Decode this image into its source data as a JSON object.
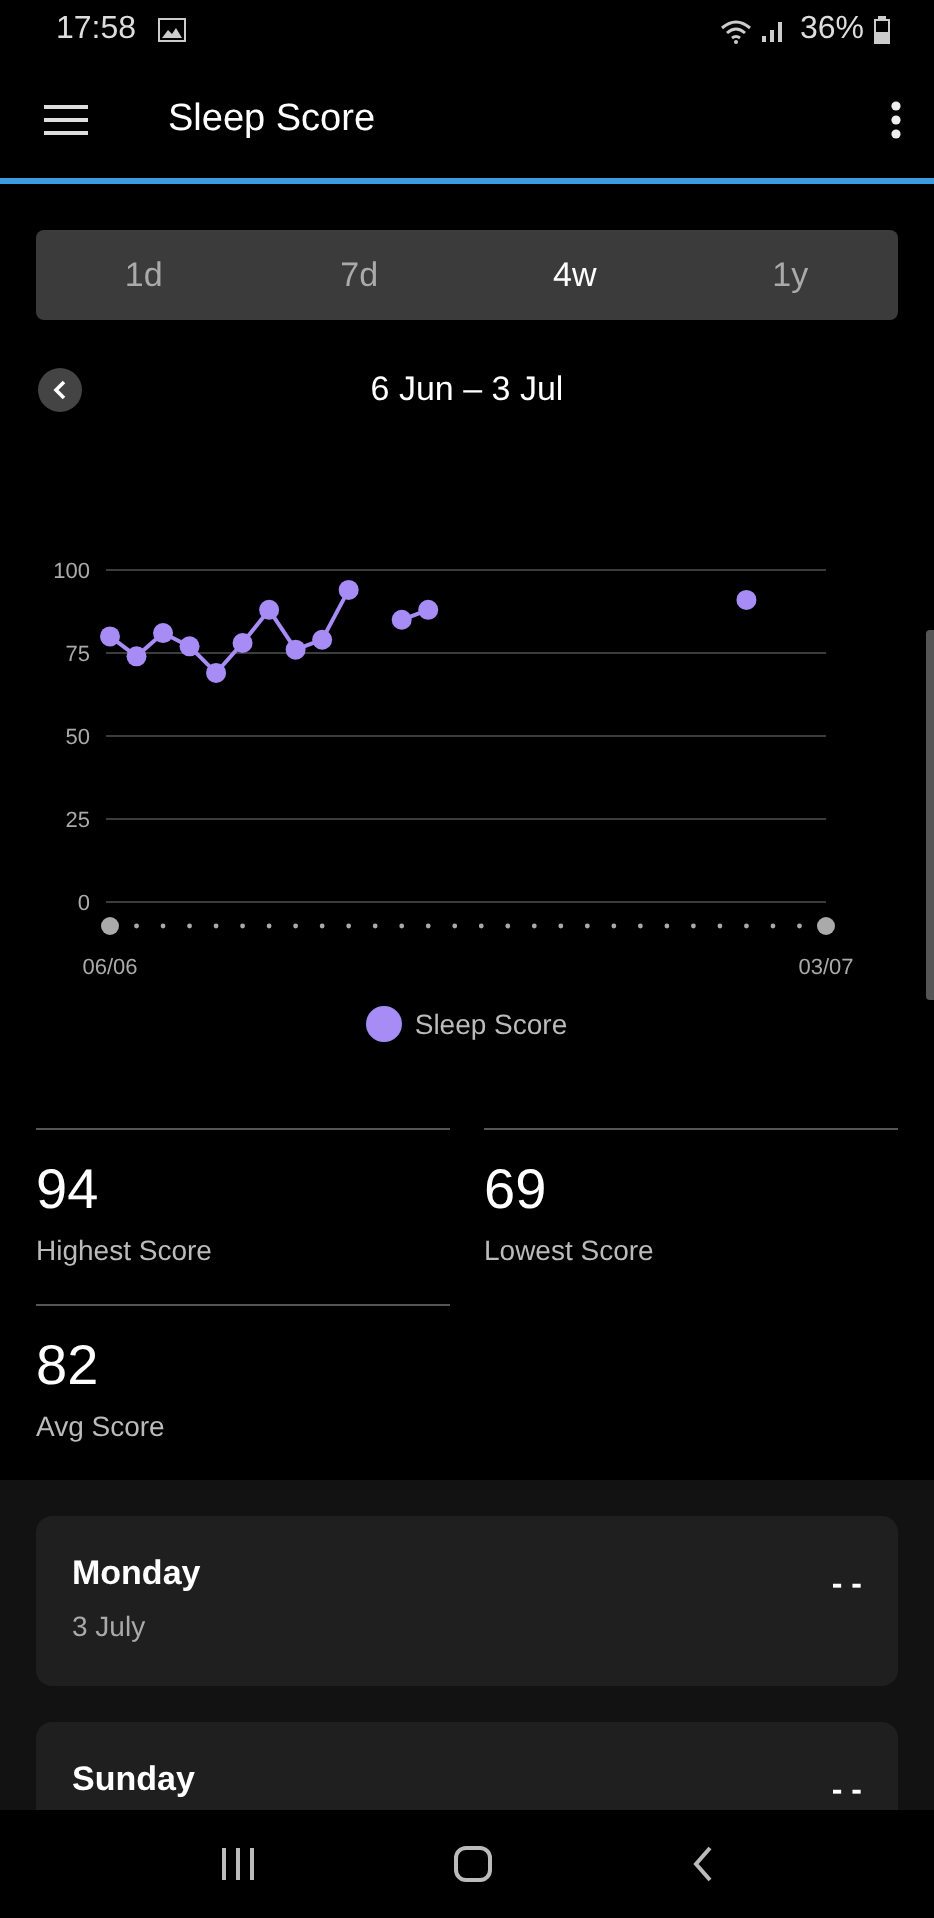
{
  "status_bar": {
    "time": "17:58",
    "battery": "36%"
  },
  "app_bar": {
    "title": "Sleep Score"
  },
  "periods": [
    {
      "label": "1d",
      "selected": false
    },
    {
      "label": "7d",
      "selected": false
    },
    {
      "label": "4w",
      "selected": true
    },
    {
      "label": "1y",
      "selected": false
    }
  ],
  "date_range": "6 Jun – 3 Jul",
  "chart": {
    "chart_data": {
      "type": "line",
      "categories": [
        "06/06",
        null,
        null,
        null,
        null,
        null,
        null,
        null,
        null,
        null,
        null,
        null,
        null,
        null,
        null,
        null,
        null,
        null,
        null,
        null,
        null,
        null,
        null,
        null,
        null,
        null,
        null,
        "03/07"
      ],
      "ylim": [
        0,
        100
      ],
      "grid": true,
      "yticks": [
        0,
        25,
        50,
        75,
        100
      ],
      "series": [
        {
          "name": "Sleep Score",
          "color": "#a88cf5",
          "marker": "circle",
          "values": [
            80,
            74,
            81,
            77,
            69,
            78,
            88,
            76,
            79,
            94,
            null,
            85,
            88,
            null,
            null,
            null,
            null,
            null,
            null,
            null,
            null,
            null,
            null,
            null,
            91,
            null,
            null,
            null
          ]
        }
      ]
    }
  },
  "stats": [
    {
      "value": "94",
      "label": "Highest Score"
    },
    {
      "value": "69",
      "label": "Lowest Score"
    },
    {
      "value": "82",
      "label": "Avg Score"
    }
  ],
  "days": [
    {
      "day": "Monday",
      "date": "3 July",
      "score": "- -"
    },
    {
      "day": "Sunday",
      "score": "- -"
    }
  ]
}
